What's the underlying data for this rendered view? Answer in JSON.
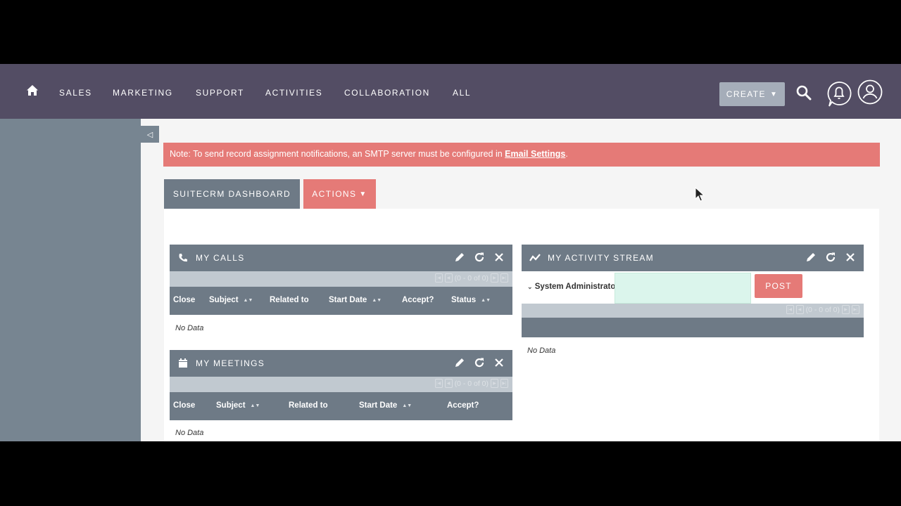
{
  "nav": {
    "items": [
      "SALES",
      "MARKETING",
      "SUPPORT",
      "ACTIVITIES",
      "COLLABORATION",
      "ALL"
    ],
    "create_label": "CREATE",
    "home_icon": "home-icon",
    "search_icon": "search-icon",
    "notification_icon": "bell-icon",
    "user_icon": "user-icon"
  },
  "notice": {
    "text": "Note: To send record assignment notifications, an SMTP server must be configured in ",
    "link": "Email Settings",
    "end": "."
  },
  "dashboard": {
    "tab_label": "SUITECRM DASHBOARD",
    "actions_label": "ACTIONS"
  },
  "calls": {
    "title": "MY CALLS",
    "pager": "(0 - 0 of 0)",
    "columns": [
      "Close",
      "Subject",
      "Related to",
      "Start Date",
      "Accept?",
      "Status"
    ],
    "empty": "No Data"
  },
  "meetings": {
    "title": "MY MEETINGS",
    "pager": "(0 - 0 of 0)",
    "columns": [
      "Close",
      "Subject",
      "Related to",
      "Start Date",
      "Accept?"
    ],
    "empty": "No Data"
  },
  "stream": {
    "title": "MY ACTIVITY STREAM",
    "user": "System Administrator",
    "post_label": "POST",
    "pager": "(0 - 0 of 0)",
    "empty": "No Data"
  },
  "colors": {
    "nav_bg": "#534d64",
    "sidebar_bg": "#778591",
    "header_bg": "#6e7a86",
    "accent": "#e57a77",
    "input_bg": "#dbf5ec"
  }
}
